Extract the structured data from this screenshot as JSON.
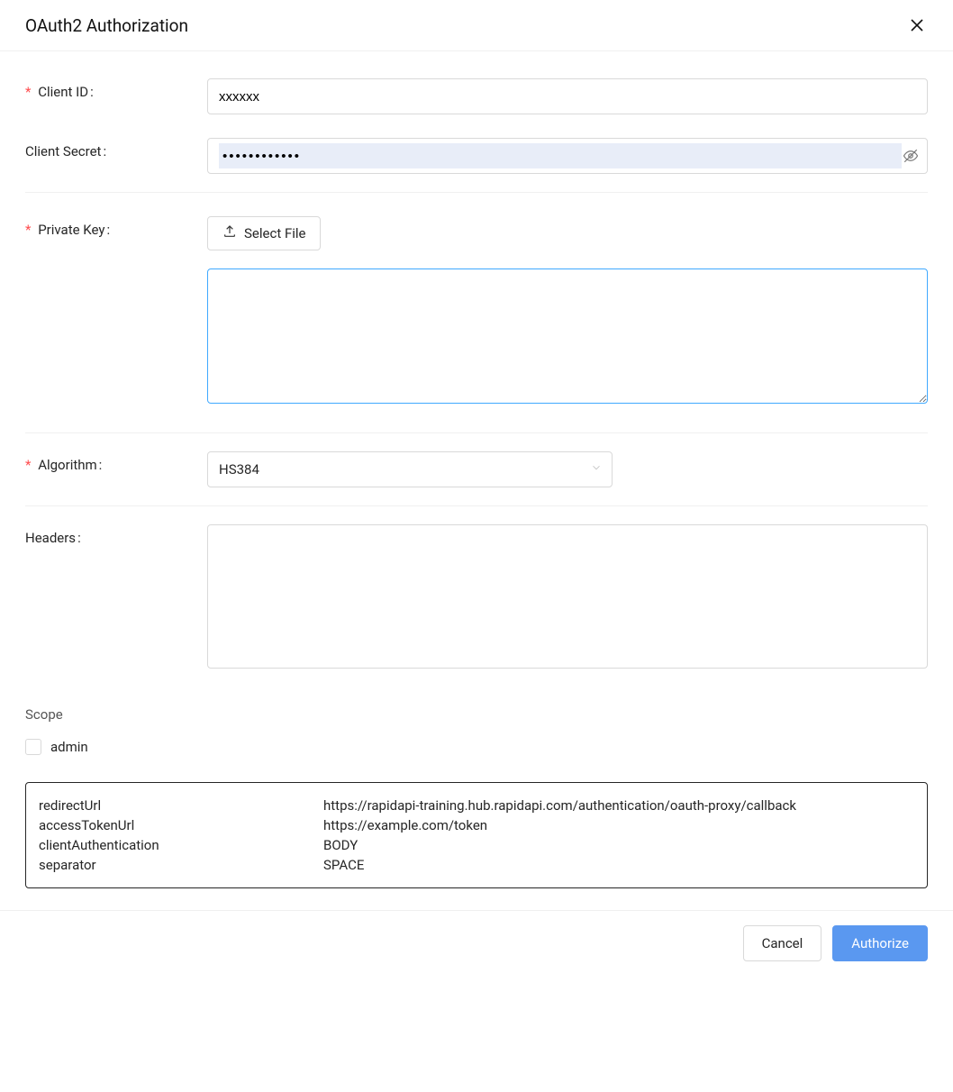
{
  "modal": {
    "title": "OAuth2 Authorization"
  },
  "form": {
    "client_id": {
      "label": "Client ID",
      "value": "xxxxxx"
    },
    "client_secret": {
      "label": "Client Secret",
      "value": "••••••••••••"
    },
    "private_key": {
      "label": "Private Key",
      "button": "Select File",
      "value": ""
    },
    "algorithm": {
      "label": "Algorithm",
      "selected": "HS384"
    },
    "headers": {
      "label": "Headers",
      "value": ""
    },
    "scope": {
      "label": "Scope",
      "options": [
        {
          "label": "admin",
          "checked": false
        }
      ]
    }
  },
  "info": [
    {
      "key": "redirectUrl",
      "value": "https://rapidapi-training.hub.rapidapi.com/authentication/oauth-proxy/callback"
    },
    {
      "key": "accessTokenUrl",
      "value": "https://example.com/token"
    },
    {
      "key": "clientAuthentication",
      "value": "BODY"
    },
    {
      "key": "separator",
      "value": "SPACE"
    }
  ],
  "footer": {
    "cancel": "Cancel",
    "authorize": "Authorize"
  }
}
